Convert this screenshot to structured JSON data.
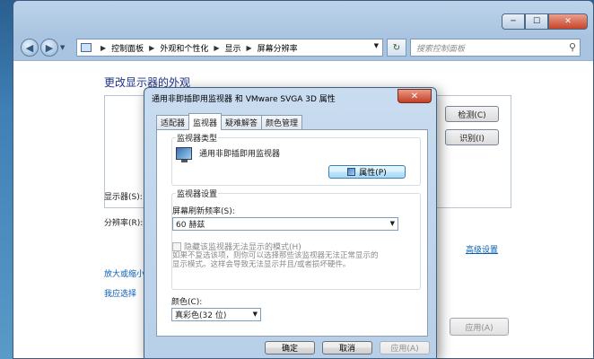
{
  "window": {
    "min_label": "─",
    "max_label": "☐",
    "close_label": "✕"
  },
  "nav": {
    "back": "◀",
    "forward": "▶",
    "dropdown": "▼",
    "breadcrumb": [
      "控制面板",
      "外观和个性化",
      "显示",
      "屏幕分辨率"
    ],
    "crumb_sep": "▶",
    "address_drop": "▼",
    "refresh": "↻",
    "search_placeholder": "搜索控制面板",
    "search_icon": "⚲"
  },
  "main": {
    "title": "更改显示器的外观",
    "detect_label": "检测(C)",
    "identify_label": "识别(I)",
    "display_label": "显示器(S):",
    "resolution_label": "分辨率(R):",
    "advanced_link": "高级设置",
    "link1": "放大或缩小",
    "link2": "我应选择",
    "apply_label": "应用(A)"
  },
  "dialog": {
    "title": "通用非即插即用监视器 和 VMware SVGA 3D 属性",
    "close": "✕",
    "tabs": [
      "适配器",
      "监视器",
      "疑难解答",
      "颜色管理"
    ],
    "active_tab": 1,
    "monitor_type_group": "监视器类型",
    "monitor_name": "通用非即插即用监视器",
    "properties_btn": "属性(P)",
    "monitor_settings_group": "监视器设置",
    "refresh_rate_label": "屏幕刷新频率(S):",
    "refresh_rate_value": "60 赫兹",
    "hide_modes_label": "隐藏该监视器无法显示的模式(H)",
    "hide_modes_desc_line1": "如果不复选该项，则你可以选择那些该监视器无法正常显示的",
    "hide_modes_desc_line2": "显示模式。这样会导致无法显示并且/或者损坏硬件。",
    "color_label": "颜色(C):",
    "color_value": "真彩色(32 位)",
    "ok": "确定",
    "cancel": "取消",
    "apply": "应用(A)"
  },
  "icons": {
    "monitor": "monitor-icon",
    "properties": "shield-properties-icon",
    "search": "search-icon"
  }
}
